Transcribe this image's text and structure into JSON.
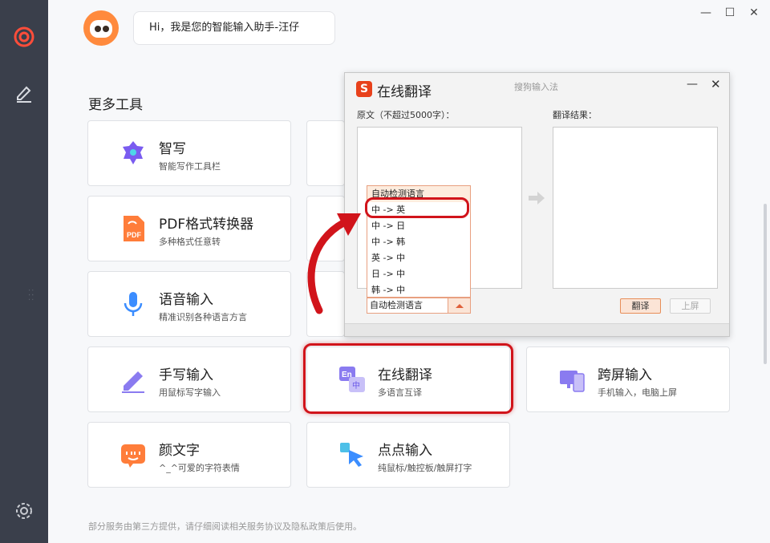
{
  "rail": {
    "icons": [
      "app-logo-icon",
      "pen-sign-icon",
      "settings-icon"
    ]
  },
  "header": {
    "greeting": "Hi，我是您的智能输入助手-汪仔"
  },
  "section_title": "更多工具",
  "tools": [
    {
      "title": "智写",
      "subtitle": "智能写作工具栏",
      "icon": "pen-nib-icon"
    },
    {
      "title": "PDF格式转换器",
      "subtitle": "多种格式任意转",
      "icon": "pdf-icon"
    },
    {
      "title": "语音输入",
      "subtitle": "精准识别各种语言方言",
      "icon": "microphone-icon"
    },
    {
      "title": "手写输入",
      "subtitle": "用鼠标写字输入",
      "icon": "handwrite-pen-icon"
    },
    {
      "title": "在线翻译",
      "subtitle": "多语言互译",
      "icon": "translate-icon"
    },
    {
      "title": "跨屏输入",
      "subtitle": "手机输入，电脑上屏",
      "icon": "cross-screen-icon"
    },
    {
      "title": "颜文字",
      "subtitle": "^_^可爱的字符表情",
      "icon": "emoticon-icon"
    },
    {
      "title": "点点输入",
      "subtitle": "纯鼠标/触控板/触屏打字",
      "icon": "click-input-icon"
    }
  ],
  "footer": "部分服务由第三方提供，请仔细阅读相关服务协议及隐私政策后使用。",
  "popup": {
    "title": "在线翻译",
    "subtitle": "搜狗输入法",
    "logo": "S",
    "source_label": "原文（不超过5000字）：",
    "result_label": "翻译结果：",
    "dropdown_items": [
      "自动检测语言",
      "中 -> 英",
      "中 -> 日",
      "中 -> 韩",
      "英 -> 中",
      "日 -> 中",
      "韩 -> 中"
    ],
    "selected": "自动检测语言",
    "highlighted_item": "中 -> 英",
    "translate_button": "翻译",
    "to_screen_button": "上屏"
  },
  "colors": {
    "accent_red": "#d1141b",
    "orange": "#e8411b",
    "purple": "#8a7bf0"
  }
}
